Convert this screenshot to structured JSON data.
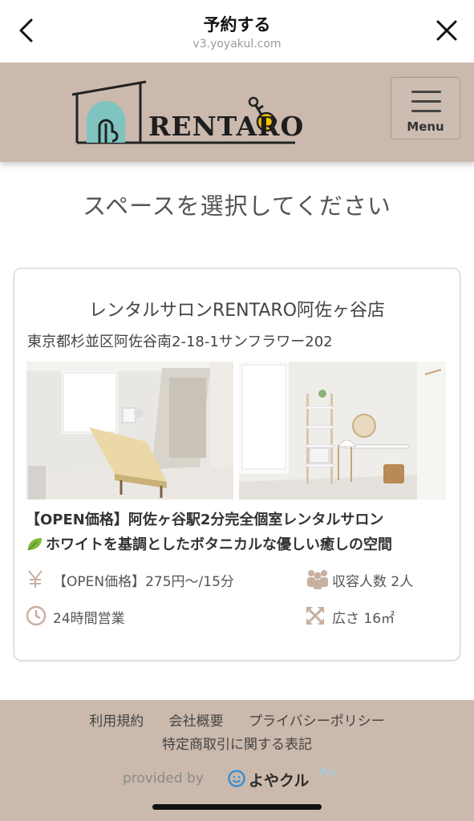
{
  "browser": {
    "title": "予約する",
    "url": "v3.yoyakul.com"
  },
  "header": {
    "logo_text": "RENTARO",
    "menu_label": "Menu"
  },
  "page_heading": "スペースを選択してください",
  "space": {
    "name": "レンタルサロンRENTARO阿佐ヶ谷店",
    "address": "東京都杉並区阿佐谷南2-18-1サンフラワー202",
    "catch_line1": "【OPEN価格】阿佐ヶ谷駅2分完全個室レンタルサロン",
    "catch_line2": "ホワイトを基調としたボタニカルな優しい癒しの空間",
    "price": "【OPEN価格】275円〜/15分",
    "capacity": "収容人数 2人",
    "hours": "24時間営業",
    "area": "広さ 16㎡"
  },
  "footer": {
    "links": [
      "利用規約",
      "会社概要",
      "プライバシーポリシー"
    ],
    "link_tokushoho": "特定商取引に関する表記",
    "provided_by": "provided by",
    "brand_name": "よやクル",
    "brand_pro": "Pro"
  },
  "colors": {
    "header_bg": "#cbb9ad",
    "logo_teal": "#7fc4c0",
    "logo_yellow": "#f2c200",
    "icon_tan": "#c8b0a0"
  },
  "icons": [
    "back-arrow-icon",
    "close-icon",
    "hamburger-icon",
    "yen-icon",
    "people-icon",
    "clock-icon",
    "expand-icon",
    "leaf-icon",
    "smile-icon"
  ]
}
